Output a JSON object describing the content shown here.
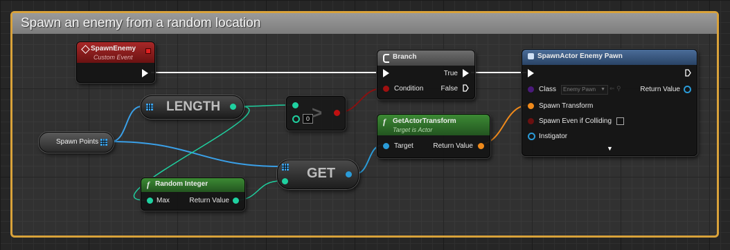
{
  "comment": {
    "title": "Spawn an enemy from a random location"
  },
  "nodes": {
    "spawn_enemy": {
      "title": "SpawnEnemy",
      "subtitle": "Custom Event"
    },
    "length": {
      "label": "LENGTH"
    },
    "compare": {
      "value": "0"
    },
    "branch": {
      "title": "Branch",
      "true_label": "True",
      "false_label": "False",
      "condition_label": "Condition"
    },
    "get_actor_transform": {
      "title": "GetActorTransform",
      "subtitle": "Target is Actor",
      "target_label": "Target",
      "return_label": "Return Value"
    },
    "spawn_actor": {
      "title": "SpawnActor Enemy Pawn",
      "class_label": "Class",
      "class_value": "Enemy Pawn",
      "return_label": "Return Value",
      "transform_label": "Spawn Transform",
      "colliding_label": "Spawn Even if Colliding",
      "instigator_label": "Instigator"
    },
    "spawn_points": {
      "label": "Spawn Points"
    },
    "random_integer": {
      "title": "Random Integer",
      "max_label": "Max",
      "return_label": "Return Value"
    },
    "get": {
      "label": "GET"
    }
  },
  "colors": {
    "comment_border": "#d9a23a",
    "event_header": "#8e1b1b",
    "func_header": "#2f6e2a",
    "branch_header": "#5a5a5a",
    "spawn_header": "#3a5a82",
    "array_pin": "#3aa0e8",
    "int_pin": "#1fd1a0",
    "bool_pin": "#8b1010",
    "transform_pin": "#f08a1b",
    "object_pin": "#2a9bd8",
    "class_pin": "#5a2a8a",
    "exec_pin": "#ffffff"
  }
}
